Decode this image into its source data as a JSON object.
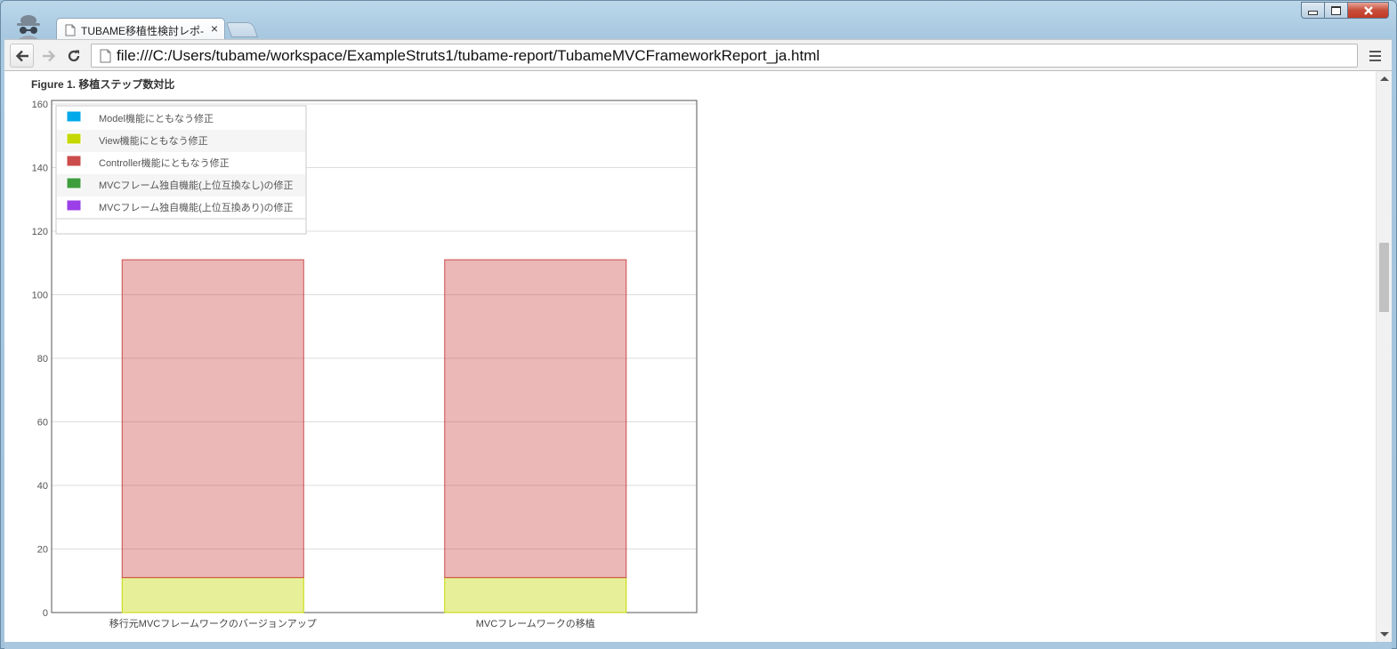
{
  "browser": {
    "tab_title": "TUBAME移植性検討レポ-",
    "tab_close": "×",
    "address": "file:///C:/Users/tubame/workspace/ExampleStruts1/tubame-report/TubameMVCFrameworkReport_ja.html",
    "icons": {
      "incognito": "incognito-icon",
      "back": "back-arrow-icon",
      "forward": "forward-arrow-icon",
      "reload": "reload-icon",
      "menu": "hamburger-menu-icon",
      "page": "page-icon"
    }
  },
  "figure": {
    "label": "Figure 1.",
    "title": "移植ステップ数対比"
  },
  "chart_data": {
    "type": "bar",
    "stacked": true,
    "title": "",
    "xlabel": "",
    "ylabel": "",
    "ylim": [
      0,
      160
    ],
    "yticks": [
      0,
      20,
      40,
      60,
      80,
      100,
      120,
      140,
      160
    ],
    "grid": true,
    "legend_position": "top-left",
    "categories": [
      "移行元MVCフレームワークのバージョンアップ",
      "MVCフレームワークの移植"
    ],
    "series": [
      {
        "name": "Model機能にともなう修正",
        "color": "#00a9e9",
        "values": [
          0,
          0
        ]
      },
      {
        "name": "View機能にともなう修正",
        "color": "#c5d800",
        "values": [
          11,
          11
        ]
      },
      {
        "name": "Controller機能にともなう修正",
        "color": "#cc4b4b",
        "values": [
          100,
          100
        ]
      },
      {
        "name": "MVCフレーム独自機能(上位互換なし)の修正",
        "color": "#3e9e3e",
        "values": [
          0,
          0
        ]
      },
      {
        "name": "MVCフレーム独自機能(上位互換あり)の修正",
        "color": "#9b3fe8",
        "values": [
          0,
          0
        ]
      }
    ]
  }
}
